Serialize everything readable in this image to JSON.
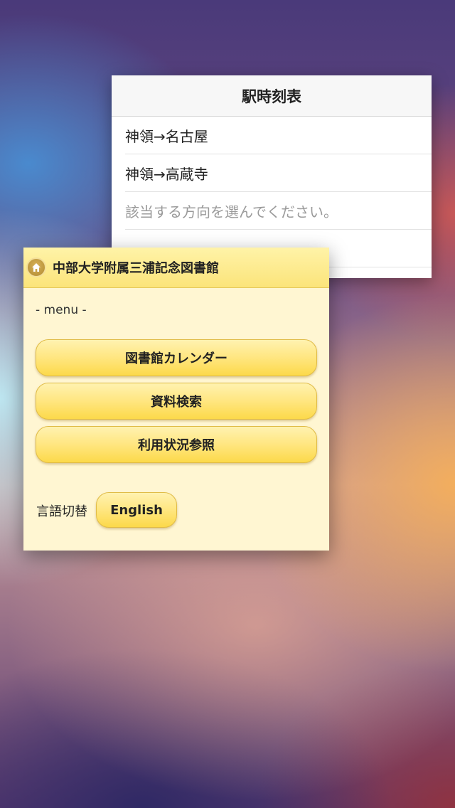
{
  "timetable": {
    "title": "駅時刻表",
    "routes": [
      "神領→名古屋",
      "神領→高蔵寺"
    ],
    "hint": "該当する方向を選んでください。"
  },
  "library": {
    "title": "中部大学附属三浦記念図書館",
    "menu_label": "- menu -",
    "buttons": [
      "図書館カレンダー",
      "資料検索",
      "利用状況参照"
    ],
    "language_label": "言語切替",
    "language_button": "English",
    "accent_color": "#ffe680"
  },
  "icons": {
    "home": "home-icon"
  }
}
